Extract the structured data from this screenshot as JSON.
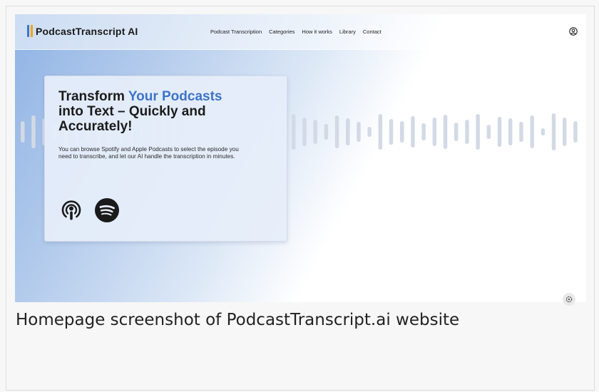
{
  "brand": {
    "name": "PodcastTranscript AI",
    "bar_colors": [
      "#3d74c9",
      "#f0a500"
    ]
  },
  "nav": {
    "links": [
      "Podcast Transcription",
      "Categories",
      "How it works",
      "Library",
      "Contact"
    ]
  },
  "hero": {
    "title_accent": "Your Podcasts",
    "title_pre": "Transform ",
    "title_post": " into Text – Quickly and Accurately!",
    "description": "You can browse Spotify and Apple Podcasts to select the episode you need to transcribe, and let our AI handle the transcription in minutes.",
    "platforms": [
      "apple-podcasts-icon",
      "spotify-icon"
    ]
  },
  "caption": "Homepage screenshot of PodcastTranscript.ai website",
  "colors": {
    "accent": "#3d74c9",
    "waveform": "#d3dae6"
  }
}
